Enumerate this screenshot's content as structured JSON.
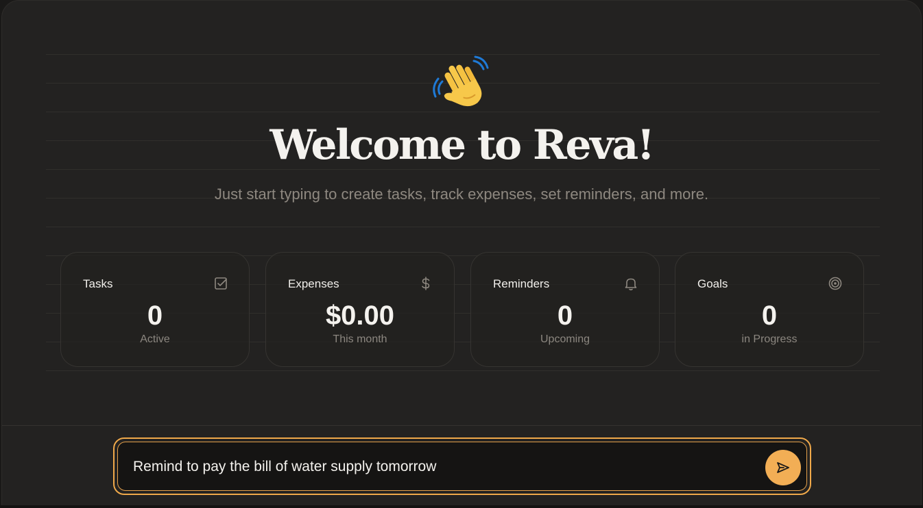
{
  "welcome": {
    "title": "Welcome to Reva!",
    "subtitle": "Just start typing to create tasks, track expenses, set reminders, and more.",
    "icon": "waving-hand-icon"
  },
  "stats": [
    {
      "label": "Tasks",
      "value": "0",
      "sub": "Active",
      "icon": "checkbox-icon"
    },
    {
      "label": "Expenses",
      "value": "$0.00",
      "sub": "This month",
      "icon": "dollar-icon"
    },
    {
      "label": "Reminders",
      "value": "0",
      "sub": "Upcoming",
      "icon": "bell-icon"
    },
    {
      "label": "Goals",
      "value": "0",
      "sub": "in Progress",
      "icon": "target-icon"
    }
  ],
  "composer": {
    "value": "Remind to pay the bill of water supply tomorrow",
    "send_icon": "send-icon"
  },
  "colors": {
    "accent": "#f2ae55",
    "background": "#232221",
    "text": "#f4f2ee",
    "muted": "#8c8780"
  }
}
